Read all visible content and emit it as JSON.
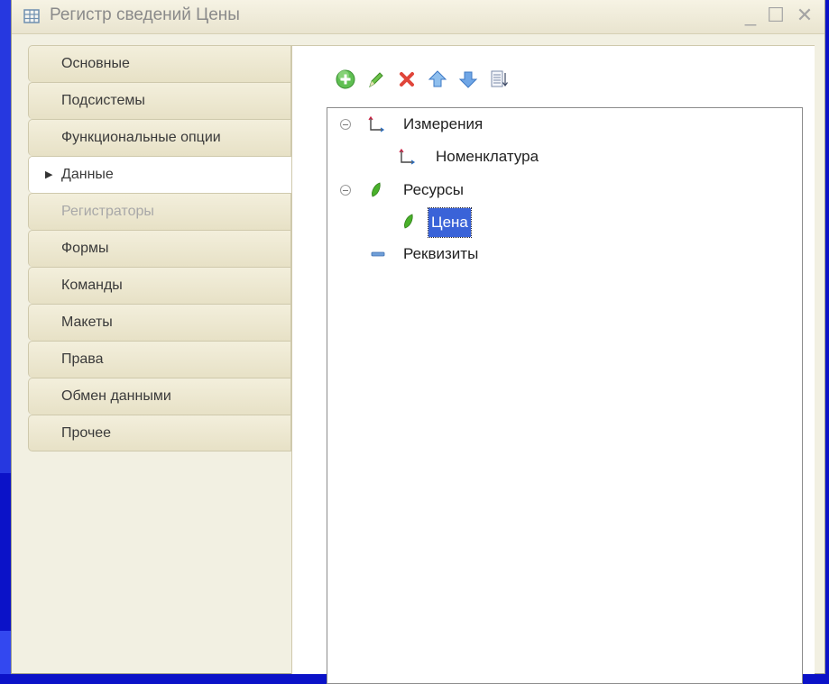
{
  "window": {
    "title": "Регистр сведений Цены",
    "controls": {
      "minimize": "_",
      "maximize": "☐",
      "close": "✕"
    }
  },
  "sidebar": {
    "tabs": [
      {
        "label": "Основные",
        "state": "normal"
      },
      {
        "label": "Подсистемы",
        "state": "normal"
      },
      {
        "label": "Функциональные опции",
        "state": "normal"
      },
      {
        "label": "Данные",
        "state": "active"
      },
      {
        "label": "Регистраторы",
        "state": "disabled"
      },
      {
        "label": "Формы",
        "state": "normal"
      },
      {
        "label": "Команды",
        "state": "normal"
      },
      {
        "label": "Макеты",
        "state": "normal"
      },
      {
        "label": "Права",
        "state": "normal"
      },
      {
        "label": "Обмен данными",
        "state": "normal"
      },
      {
        "label": "Прочее",
        "state": "normal"
      }
    ]
  },
  "toolbar": {
    "icons": [
      "add-icon",
      "edit-icon",
      "delete-icon",
      "move-up-icon",
      "move-down-icon",
      "sort-icon"
    ]
  },
  "tree": {
    "nodes": [
      {
        "label": "Измерения",
        "icon": "dimension-icon",
        "expanded": true
      },
      {
        "label": "Номенклатура",
        "icon": "dimension-icon"
      },
      {
        "label": "Ресурсы",
        "icon": "resource-icon",
        "expanded": true
      },
      {
        "label": "Цена",
        "icon": "resource-icon",
        "selected": true
      },
      {
        "label": "Реквизиты",
        "icon": "attribute-icon"
      }
    ]
  },
  "colors": {
    "slide_background": "#0b12c8",
    "window_background": "#f2f0e2",
    "selection": "#3a63d8",
    "resource_green": "#49b02a",
    "delete_red": "#e0453a",
    "arrow_blue": "#4a86d8"
  }
}
